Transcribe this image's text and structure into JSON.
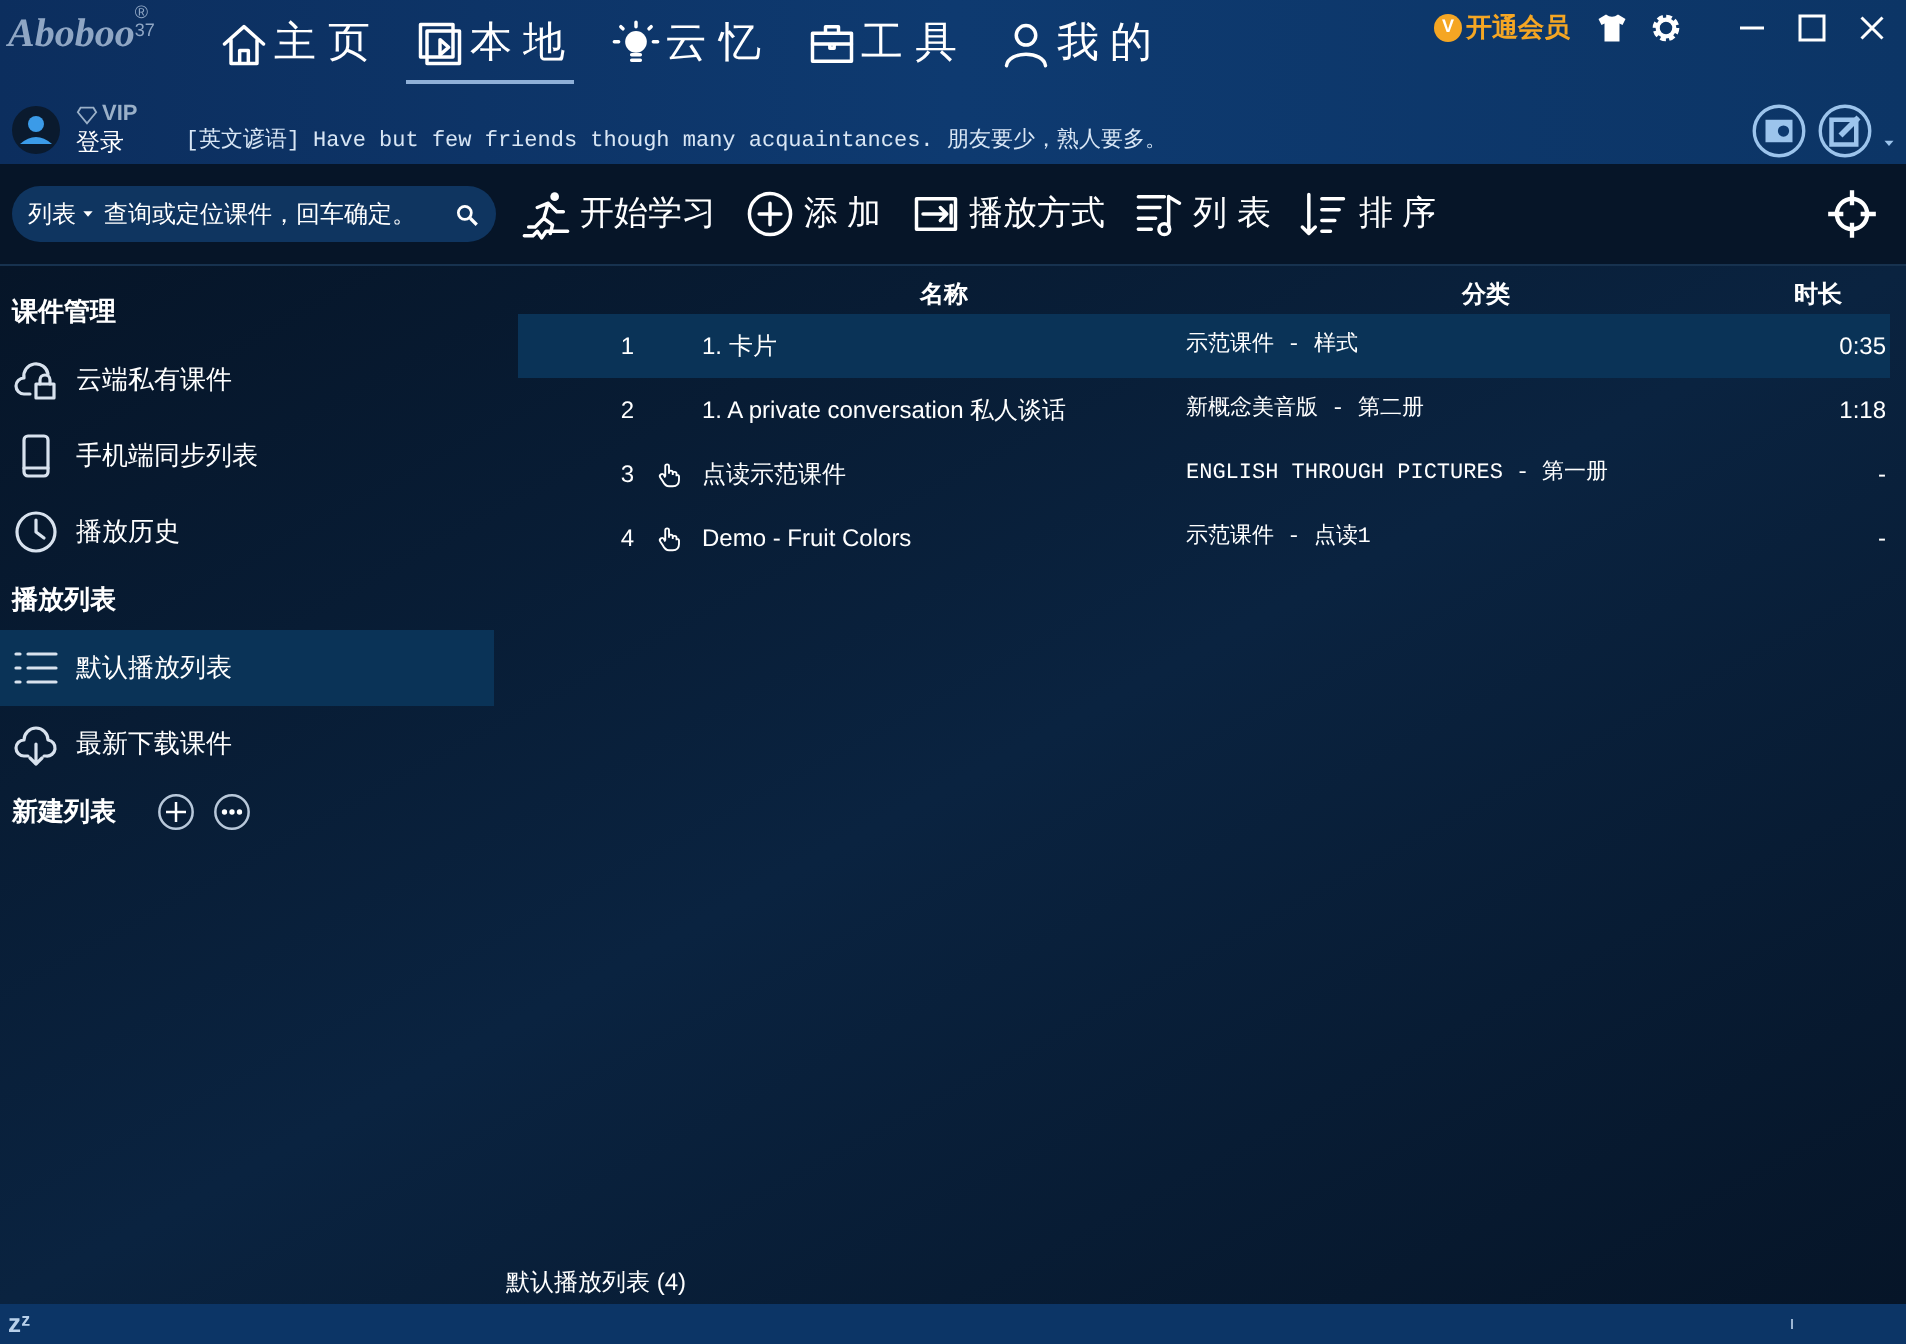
{
  "logo": {
    "name": "Aboboo",
    "mark": "®",
    "version": "37"
  },
  "nav": [
    {
      "label": "主 页",
      "selected": false
    },
    {
      "label": "本 地",
      "selected": true
    },
    {
      "label": "云 忆",
      "selected": false
    },
    {
      "label": "工 具",
      "selected": false
    },
    {
      "label": "我 的",
      "selected": false
    }
  ],
  "vip_button": {
    "badge": "V",
    "label": "开通会员"
  },
  "user": {
    "vip": "VIP",
    "login": "登录"
  },
  "proverb": "[英文谚语] Have but few friends though many acquaintances. 朋友要少，熟人要多。",
  "search": {
    "scope": "列表",
    "placeholder": "查询或定位课件，回车确定。"
  },
  "toolbar": [
    {
      "label": "开始学习"
    },
    {
      "label": "添 加"
    },
    {
      "label": "播放方式"
    },
    {
      "label": "列 表"
    },
    {
      "label": "排 序"
    }
  ],
  "sidebar": [
    {
      "heading": "课件管理",
      "items": [
        {
          "label": "云端私有课件",
          "selected": false
        },
        {
          "label": "手机端同步列表",
          "selected": false
        },
        {
          "label": "播放历史",
          "selected": false
        }
      ]
    },
    {
      "heading": "播放列表",
      "items": [
        {
          "label": "默认播放列表",
          "selected": true
        },
        {
          "label": "最新下载课件",
          "selected": false
        }
      ]
    },
    {
      "heading": "新建列表"
    }
  ],
  "table": {
    "columns": [
      "名称",
      "分类",
      "时长"
    ],
    "rows": [
      {
        "index": "1",
        "touch_read": false,
        "name": "1. 卡片",
        "category": "示范课件 - 样式",
        "duration": "0:35",
        "selected": true
      },
      {
        "index": "2",
        "touch_read": false,
        "name": "1. A private conversation 私人谈话",
        "category": "新概念美音版 - 第二册",
        "duration": "1:18",
        "selected": false
      },
      {
        "index": "3",
        "touch_read": true,
        "name": "点读示范课件",
        "category": "ENGLISH THROUGH PICTURES - 第一册",
        "duration": "-",
        "selected": false
      },
      {
        "index": "4",
        "touch_read": true,
        "name": "Demo - Fruit Colors",
        "category": "示范课件 - 点读1",
        "duration": "-",
        "selected": false
      }
    ]
  },
  "footer": "默认播放列表 (4)",
  "status_bar": {
    "sleep": "zᶻ"
  }
}
